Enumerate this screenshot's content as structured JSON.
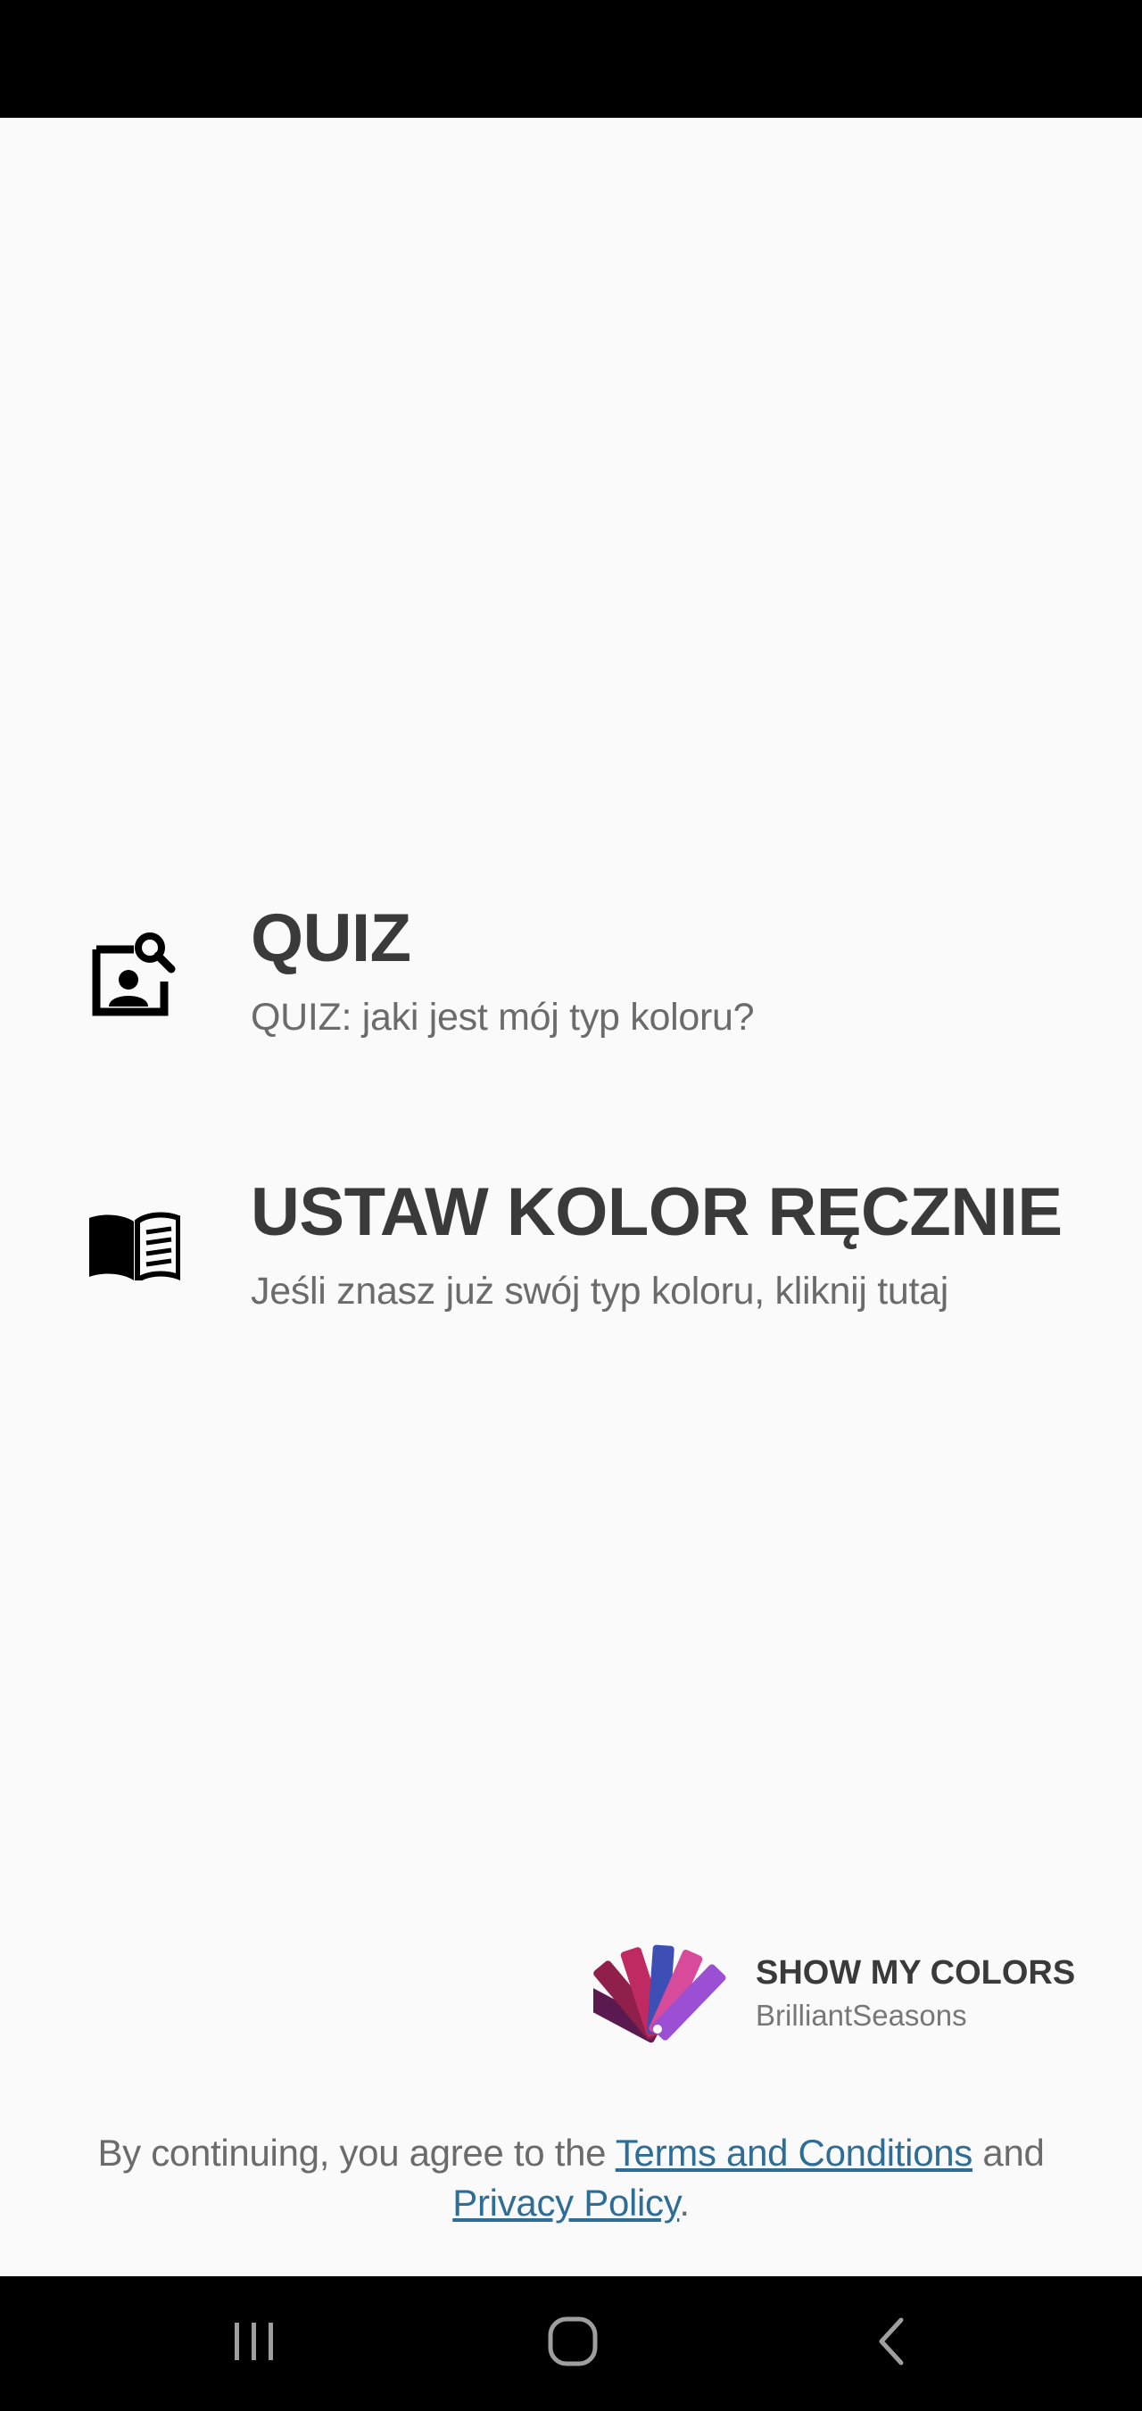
{
  "options": [
    {
      "icon": "person-search-icon",
      "title": "QUIZ",
      "subtitle": "QUIZ: jaki jest mój typ koloru?"
    },
    {
      "icon": "open-book-icon",
      "title": "USTAW KOLOR RĘCZNIE",
      "subtitle": "Jeśli znasz już swój typ koloru, kliknij tutaj"
    }
  ],
  "brand": {
    "logo_icon": "color-swatch-fan-logo",
    "title": "SHOW MY COLORS",
    "subtitle": "BrilliantSeasons"
  },
  "legal": {
    "prefix": "By continuing, you agree to the ",
    "terms_link": "Terms and Conditions",
    "middle": " and ",
    "privacy_link": "Privacy Policy",
    "suffix": "."
  },
  "nav": {
    "recent_icon": "recent-apps-icon",
    "home_icon": "home-icon",
    "back_icon": "back-icon"
  },
  "colors": {
    "background": "#fafafa",
    "title_text": "#3a3a3a",
    "subtitle_text": "#6b6b6b",
    "link": "#2e6d96",
    "system_bars": "#000000"
  }
}
